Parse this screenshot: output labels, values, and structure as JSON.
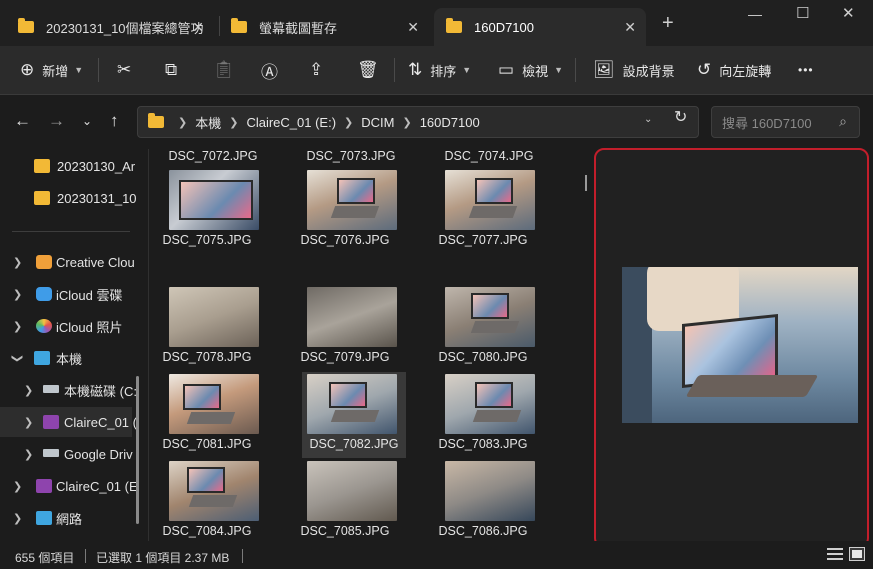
{
  "tabs": [
    {
      "title": "20230131_10個檔案總管功",
      "active": false
    },
    {
      "title": "螢幕截圖暫存",
      "active": false
    },
    {
      "title": "160D7100",
      "active": true
    }
  ],
  "toolbar": {
    "new_label": "新增",
    "sort_label": "排序",
    "view_label": "檢視",
    "set_background_label": "設成背景",
    "rotate_left_label": "向左旋轉",
    "more_label": "•••"
  },
  "address": {
    "crumbs": [
      "本機",
      "ClaireC_01 (E:)",
      "DCIM",
      "160D7100"
    ]
  },
  "search": {
    "placeholder": "搜尋 160D7100"
  },
  "sidebar": {
    "items": [
      {
        "label": "20230130_Ar",
        "icon": "folder-icon"
      },
      {
        "label": "20230131_10",
        "icon": "folder-icon"
      },
      {
        "label": "Creative Clou",
        "icon": "creative-cloud-icon"
      },
      {
        "label": "iCloud 雲碟",
        "icon": "icloud-drive-icon"
      },
      {
        "label": "iCloud 照片",
        "icon": "icloud-photos-icon"
      },
      {
        "label": "本機",
        "icon": "this-pc-icon"
      },
      {
        "label": "本機磁碟 (C:",
        "icon": "local-disk-icon"
      },
      {
        "label": "ClaireC_01 (",
        "icon": "usb-drive-icon"
      },
      {
        "label": "Google Driv",
        "icon": "google-drive-icon"
      },
      {
        "label": "ClaireC_01 (E",
        "icon": "usb-drive-icon"
      },
      {
        "label": "網路",
        "icon": "network-icon"
      }
    ]
  },
  "files": [
    "DSC_7072.JPG",
    "DSC_7073.JPG",
    "DSC_7074.JPG",
    "DSC_7075.JPG",
    "DSC_7076.JPG",
    "DSC_7077.JPG",
    "DSC_7078.JPG",
    "DSC_7079.JPG",
    "DSC_7080.JPG",
    "DSC_7081.JPG",
    "DSC_7082.JPG",
    "DSC_7083.JPG",
    "DSC_7084.JPG",
    "DSC_7085.JPG",
    "DSC_7086.JPG"
  ],
  "selected_file": "DSC_7082.JPG",
  "status": {
    "item_count": "655 個項目",
    "selection": "已選取 1 個項目 2.37 MB"
  },
  "colors": {
    "accent_folder": "#f2b936",
    "preview_highlight": "#c21e2b",
    "background": "#1c1c1c"
  }
}
